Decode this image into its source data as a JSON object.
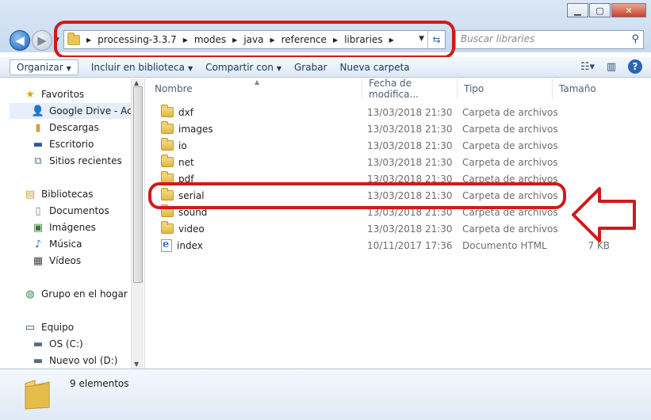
{
  "address": {
    "breadcrumbs": [
      "processing-3.3.7",
      "modes",
      "java",
      "reference",
      "libraries"
    ]
  },
  "search": {
    "placeholder": "Buscar libraries"
  },
  "toolbar": {
    "organize": "Organizar",
    "include_in_library": "Incluir en biblioteca",
    "share_with": "Compartir con",
    "burn": "Grabar",
    "new_folder": "Nueva carpeta"
  },
  "nav": {
    "favorites": "Favoritos",
    "google_drive": "Google Drive - Acce",
    "downloads": "Descargas",
    "desktop": "Escritorio",
    "recent": "Sitios recientes",
    "libraries": "Bibliotecas",
    "documents": "Documentos",
    "pictures": "Imágenes",
    "music": "Música",
    "videos": "Vídeos",
    "homegroup": "Grupo en el hogar",
    "computer": "Equipo",
    "drive_c": "OS (C:)",
    "drive_d": "Nuevo vol (D:)"
  },
  "columns": {
    "name": "Nombre",
    "date": "Fecha de modifica...",
    "type": "Tipo",
    "size": "Tamaño"
  },
  "files": [
    {
      "name": "dxf",
      "date": "13/03/2018 21:30",
      "type": "Carpeta de archivos",
      "size": "",
      "icon": "folder-icon"
    },
    {
      "name": "images",
      "date": "13/03/2018 21:30",
      "type": "Carpeta de archivos",
      "size": "",
      "icon": "folder-icon"
    },
    {
      "name": "io",
      "date": "13/03/2018 21:30",
      "type": "Carpeta de archivos",
      "size": "",
      "icon": "folder-icon"
    },
    {
      "name": "net",
      "date": "13/03/2018 21:30",
      "type": "Carpeta de archivos",
      "size": "",
      "icon": "folder-icon"
    },
    {
      "name": "pdf",
      "date": "13/03/2018 21:30",
      "type": "Carpeta de archivos",
      "size": "",
      "icon": "folder-icon"
    },
    {
      "name": "serial",
      "date": "13/03/2018 21:30",
      "type": "Carpeta de archivos",
      "size": "",
      "icon": "folder-icon"
    },
    {
      "name": "sound",
      "date": "13/03/2018 21:30",
      "type": "Carpeta de archivos",
      "size": "",
      "icon": "folder-icon"
    },
    {
      "name": "video",
      "date": "13/03/2018 21:30",
      "type": "Carpeta de archivos",
      "size": "",
      "icon": "folder-icon"
    },
    {
      "name": "index",
      "date": "10/11/2017 17:36",
      "type": "Documento HTML",
      "size": "7 KB",
      "icon": "html-file-icon"
    }
  ],
  "status": {
    "item_count": "9 elementos"
  },
  "colors": {
    "annotation": "#d11a1a",
    "accent": "#1e395b"
  }
}
